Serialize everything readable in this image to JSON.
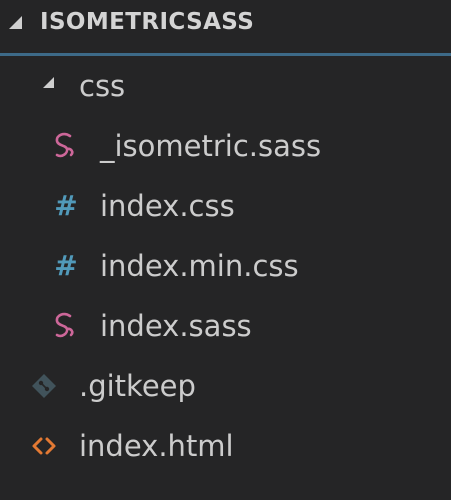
{
  "explorer": {
    "title": "ISOMETRICSASS",
    "items": [
      {
        "label": "css",
        "kind": "folder",
        "icon": "folder-expanded-icon"
      },
      {
        "label": "_isometric.sass",
        "kind": "file",
        "icon": "sass-icon",
        "color": "#cd6799"
      },
      {
        "label": "index.css",
        "kind": "file",
        "icon": "css-hash-icon",
        "color": "#519aba"
      },
      {
        "label": "index.min.css",
        "kind": "file",
        "icon": "css-hash-icon",
        "color": "#519aba"
      },
      {
        "label": "index.sass",
        "kind": "file",
        "icon": "sass-icon",
        "color": "#cd6799"
      },
      {
        "label": ".gitkeep",
        "kind": "file",
        "icon": "git-icon",
        "color": "#41535b"
      },
      {
        "label": "index.html",
        "kind": "file",
        "icon": "html-icon",
        "color": "#e37933"
      }
    ]
  },
  "colors": {
    "background": "#252526",
    "text": "#cccccc",
    "header_rule": "#3d6a88"
  }
}
